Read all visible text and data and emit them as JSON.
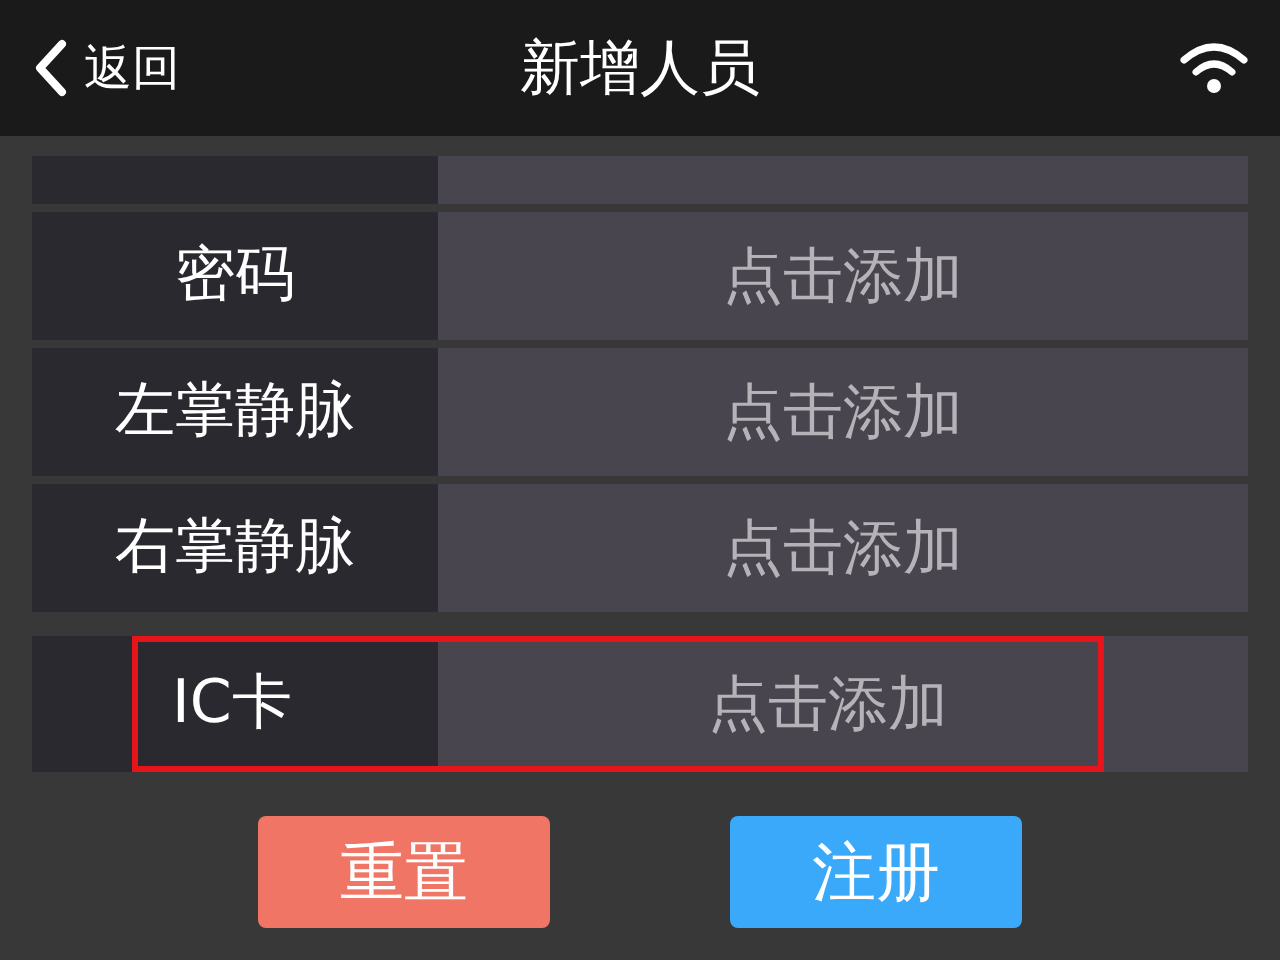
{
  "header": {
    "back": "返回",
    "title": "新增人员"
  },
  "rows": [
    {
      "kind": "stub",
      "highlighted": false
    },
    {
      "kind": "field",
      "label": "密码",
      "value": "点击添加",
      "highlighted": false
    },
    {
      "kind": "field",
      "label": "左掌静脉",
      "value": "点击添加",
      "highlighted": false
    },
    {
      "kind": "field",
      "label": "右掌静脉",
      "value": "点击添加",
      "highlighted": false
    },
    {
      "kind": "field",
      "label": "IC卡",
      "value": "点击添加",
      "highlighted": true
    }
  ],
  "buttons": [
    {
      "kind": "reset",
      "label": "重置"
    },
    {
      "kind": "submit",
      "label": "注册"
    }
  ]
}
